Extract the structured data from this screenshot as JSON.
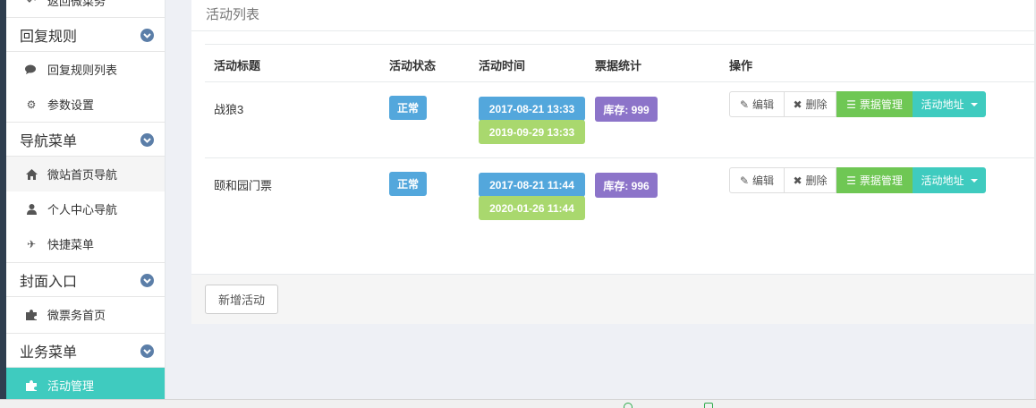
{
  "sidebar": {
    "top_item": "返回微菜务",
    "groups": [
      {
        "label": "回复规则",
        "items": [
          "回复规则列表",
          "参数设置"
        ]
      },
      {
        "label": "导航菜单",
        "items": [
          "微站首页导航",
          "个人中心导航",
          "快捷菜单"
        ]
      },
      {
        "label": "封面入口",
        "items": [
          "微票务首页"
        ]
      },
      {
        "label": "业务菜单",
        "items": [
          "活动管理"
        ]
      }
    ],
    "icons": [
      "comments-icon",
      "gear-icon",
      "home-icon",
      "user-icon",
      "plane-icon",
      "puzzle-icon",
      "puzzle-icon"
    ],
    "active_item": "活动管理"
  },
  "panel": {
    "title": "活动列表",
    "columns": [
      "活动标题",
      "活动状态",
      "活动时间",
      "票据统计",
      "操作"
    ],
    "rows": [
      {
        "title": "战狼3",
        "status": "正常",
        "start": "2017-08-21 13:33",
        "end": "2019-09-29 13:33",
        "stock": "库存: 999"
      },
      {
        "title": "颐和园门票",
        "status": "正常",
        "start": "2017-08-21 11:44",
        "end": "2020-01-26 11:44",
        "stock": "库存: 996"
      }
    ],
    "actions": {
      "edit": "编辑",
      "delete": "删除",
      "manage": "票据管理",
      "address": "活动地址"
    },
    "add_button": "新增活动"
  },
  "colors": {
    "accent_teal": "#3fcbbf",
    "label_blue": "#53a7dc",
    "label_green": "#a9d86e",
    "label_purple": "#8c74c9",
    "button_green": "#6fc754",
    "chevron_blue": "#5b7ea8"
  }
}
